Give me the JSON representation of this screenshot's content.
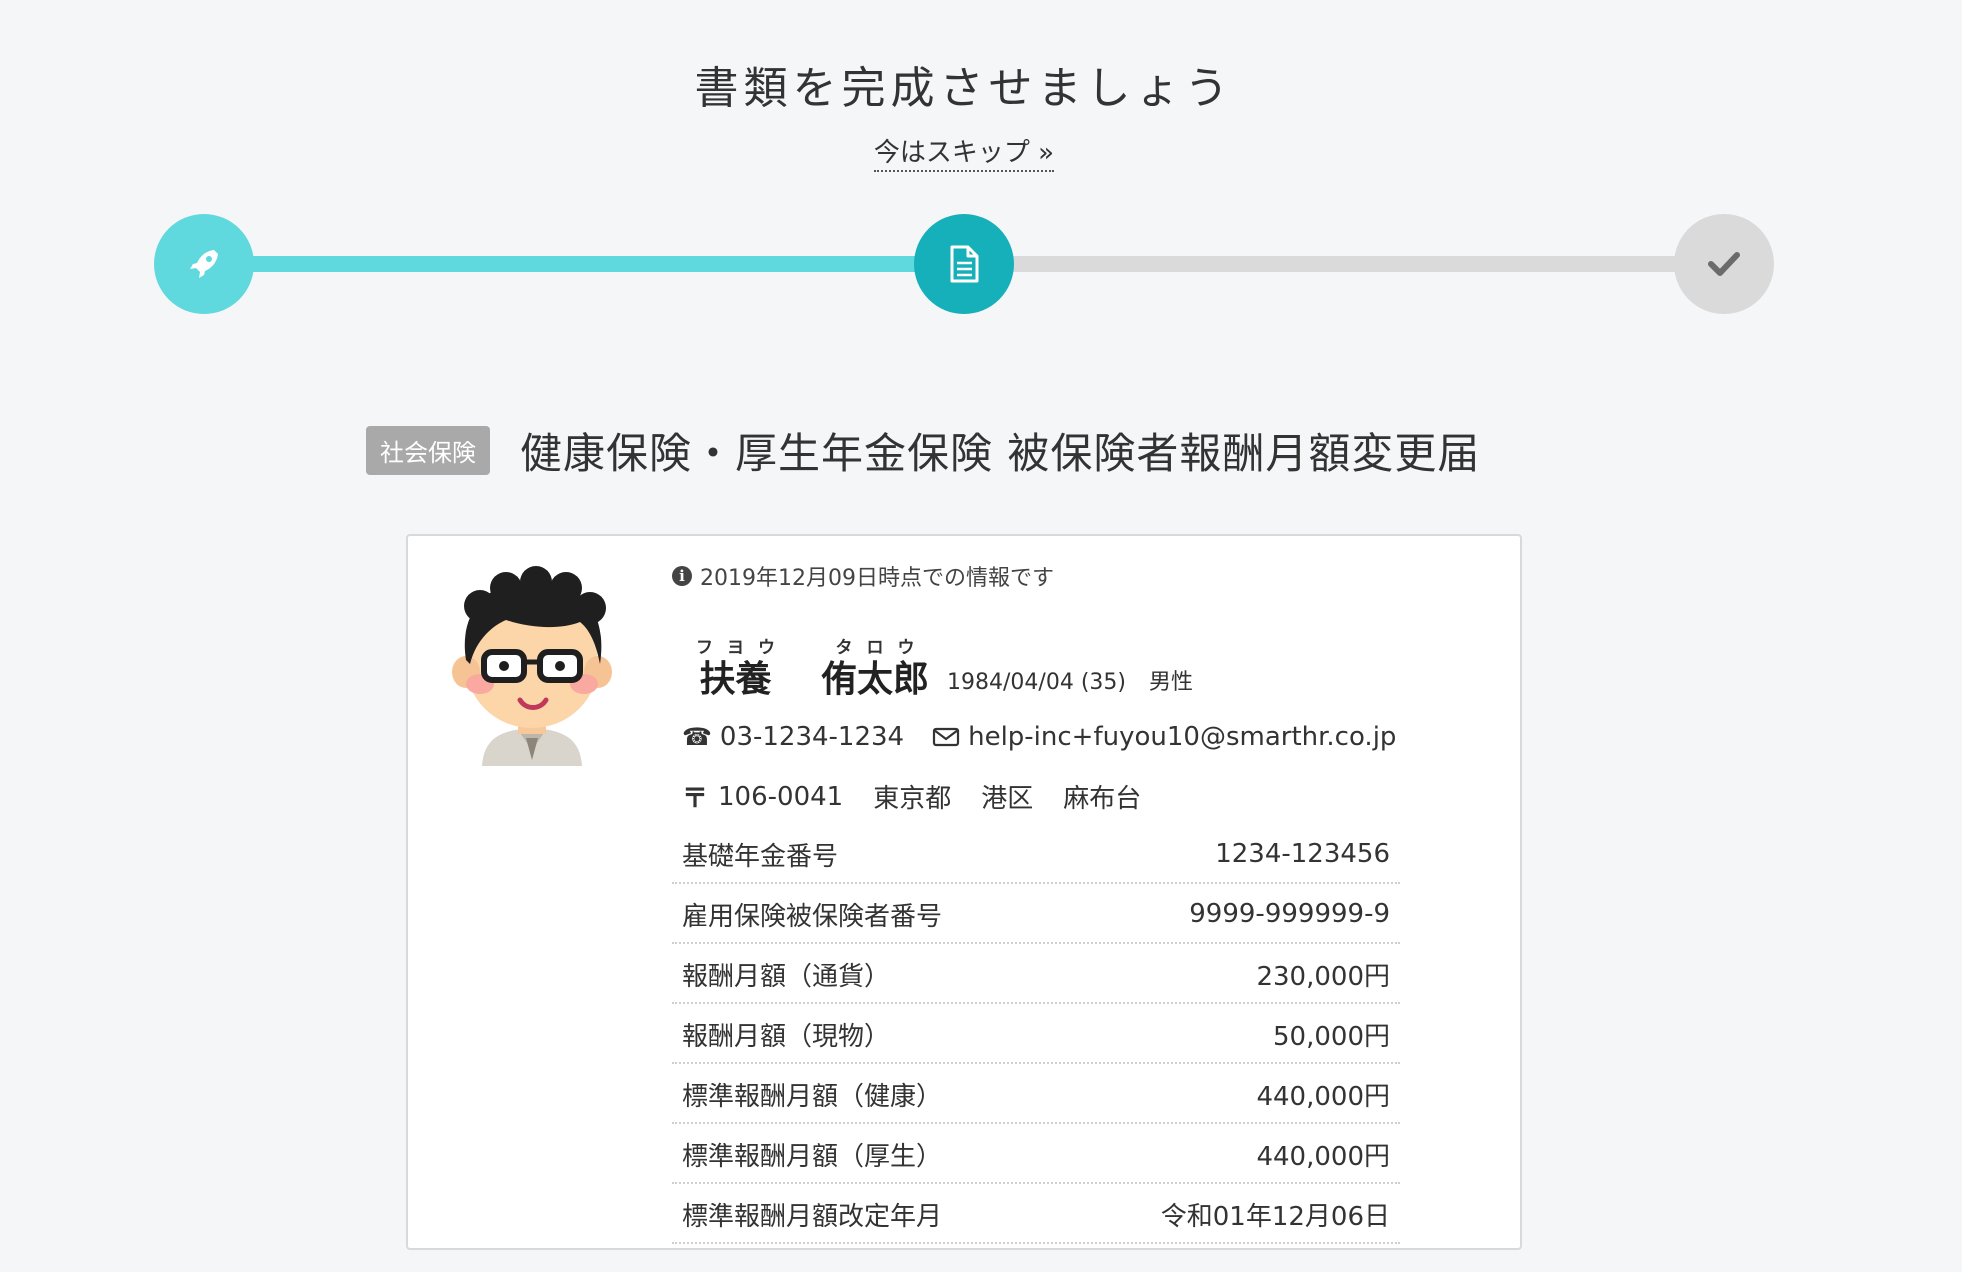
{
  "header": {
    "title": "書類を完成させましょう",
    "skip_label": "今はスキップ »"
  },
  "progress": {
    "steps": [
      {
        "icon": "rocket-icon",
        "state": "done"
      },
      {
        "icon": "document-icon",
        "state": "current"
      },
      {
        "icon": "check-icon",
        "state": "todo"
      }
    ],
    "colors": {
      "done": "#5fd8de",
      "current": "#16b0ba",
      "todo": "#dadada"
    }
  },
  "document": {
    "category": "社会保険",
    "title": "健康保険・厚生年金保険 被保険者報酬月額変更届"
  },
  "employee": {
    "info_note": "2019年12月09日時点での情報です",
    "last_name": "扶養",
    "last_name_kana": "フヨウ",
    "first_name": "侑太郎",
    "first_name_kana": "タロウ",
    "birthdate": "1984/04/04",
    "age": "(35)",
    "gender": "男性",
    "phone": "03-1234-1234",
    "email": "help-inc+fuyou10@smarthr.co.jp",
    "postal_mark": "〒",
    "postal_code": "106-0041",
    "prefecture": "東京都",
    "city": "港区",
    "town": "麻布台"
  },
  "fields": [
    {
      "label": "基礎年金番号",
      "value": "1234-123456"
    },
    {
      "label": "雇用保険被保険者番号",
      "value": "9999-999999-9"
    },
    {
      "label": "報酬月額（通貨）",
      "value": "230,000円"
    },
    {
      "label": "報酬月額（現物）",
      "value": "50,000円"
    },
    {
      "label": "標準報酬月額（健康）",
      "value": "440,000円"
    },
    {
      "label": "標準報酬月額（厚生）",
      "value": "440,000円"
    },
    {
      "label": "標準報酬月額改定年月",
      "value": "令和01年12月06日"
    }
  ]
}
